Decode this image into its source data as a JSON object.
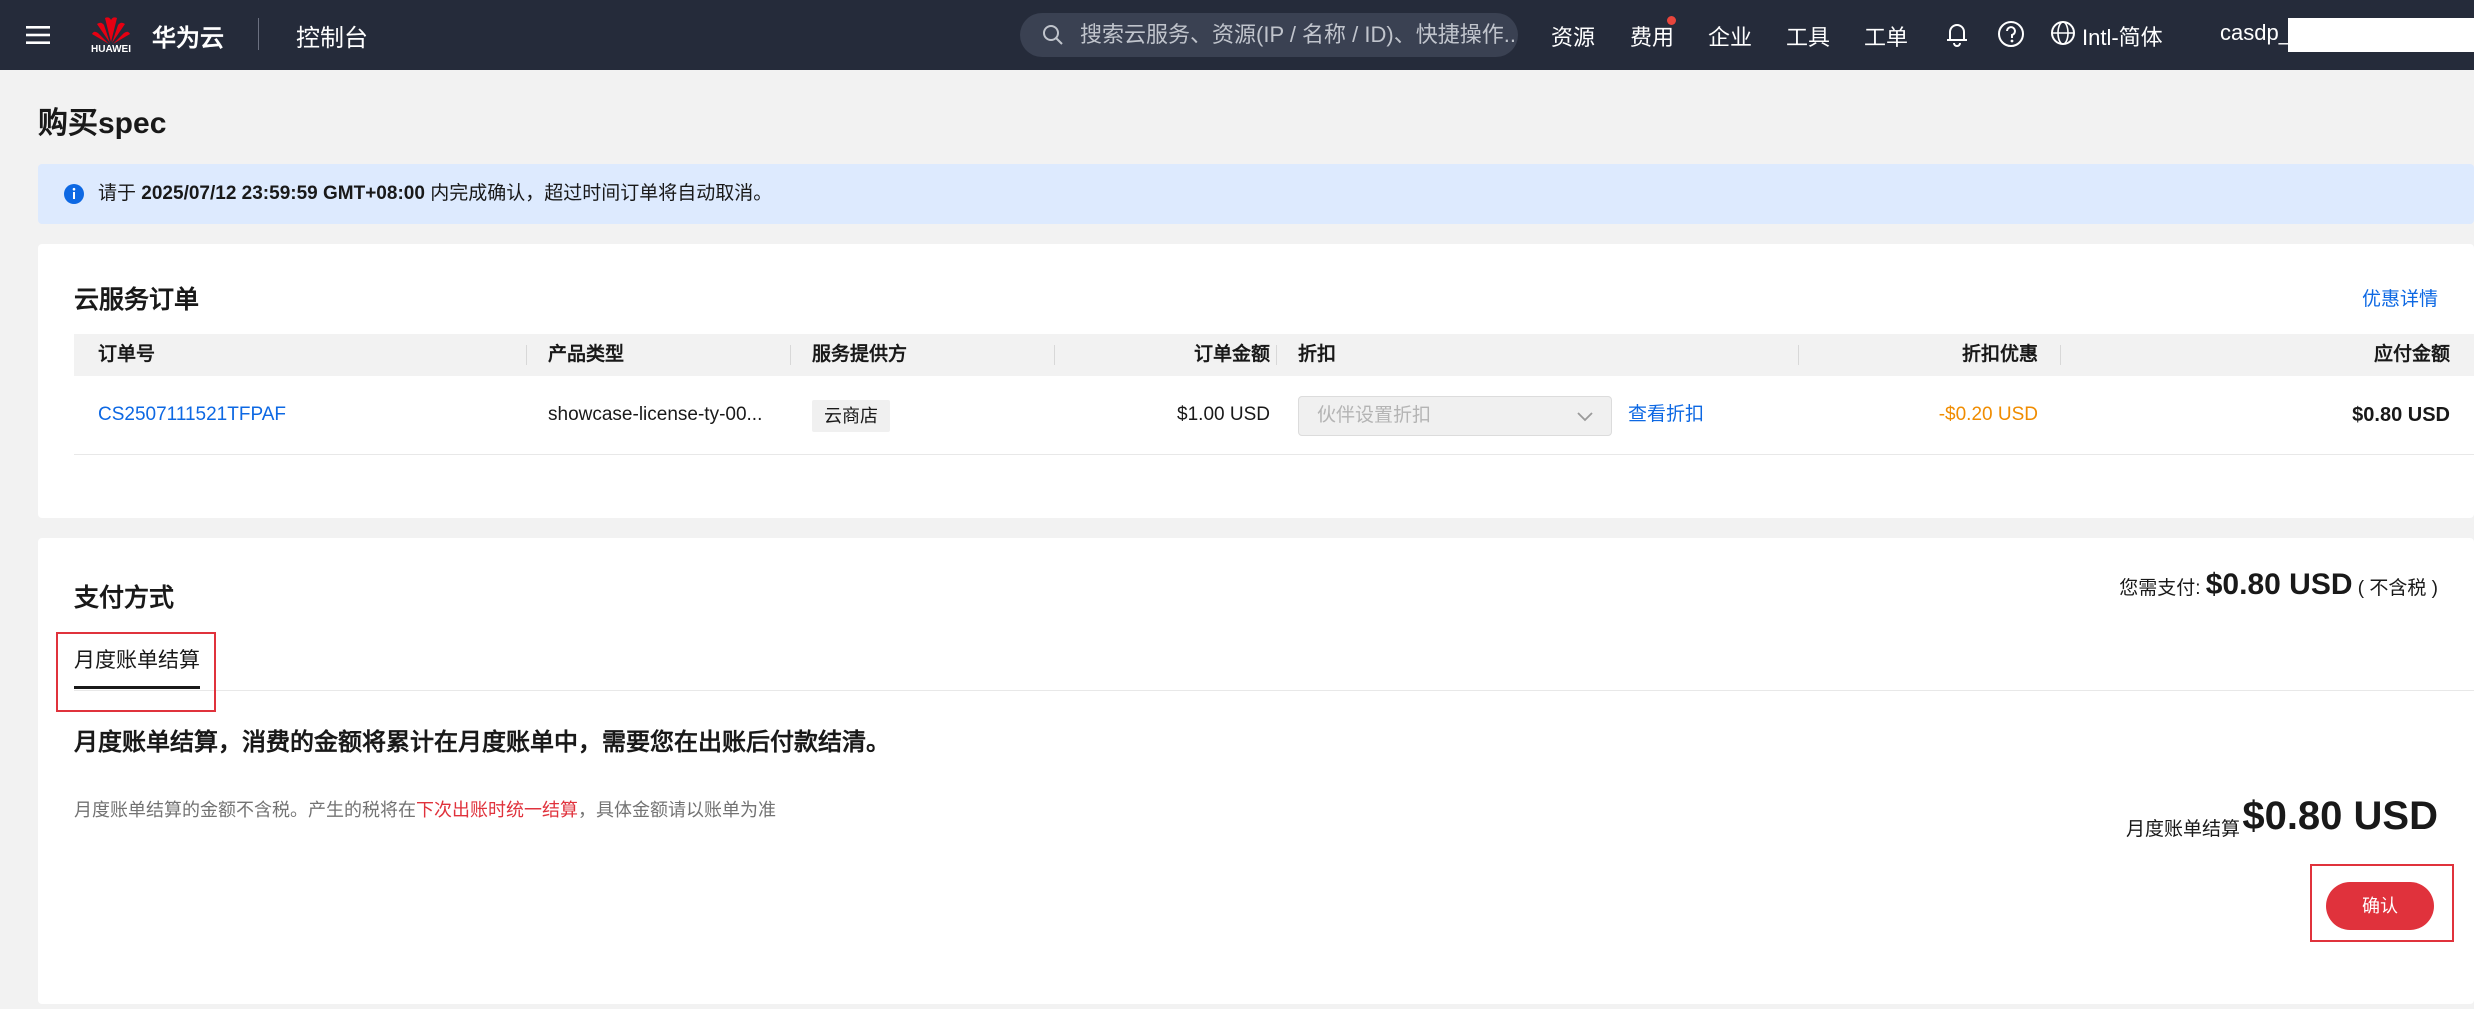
{
  "topbar": {
    "logo_text": "HUAWEI",
    "brand": "华为云",
    "console": "控制台",
    "search_placeholder": "搜索云服务、资源(IP / 名称 / ID)、快捷操作...",
    "nav": [
      "资源",
      "费用",
      "企业",
      "工具",
      "工单"
    ],
    "language": "Intl-简体",
    "user": "casdp_"
  },
  "page": {
    "title": "购买spec"
  },
  "notice": {
    "prefix": "请于",
    "deadline": "2025/07/12 23:59:59 GMT+08:00",
    "suffix": "内完成确认，超过时间订单将自动取消。"
  },
  "order": {
    "title": "云服务订单",
    "coupon_link": "优惠详情",
    "columns": [
      "订单号",
      "产品类型",
      "服务提供方",
      "订单金额",
      "折扣",
      "折扣优惠",
      "应付金额"
    ],
    "row": {
      "order_id": "CS2507111521TFPAF",
      "product_type": "showcase-license-ty-00...",
      "provider": "云商店",
      "amount": "$1.00 USD",
      "discount_placeholder": "伙伴设置折扣",
      "view_discount": "查看折扣",
      "discount_value": "-$0.20 USD",
      "payable": "$0.80 USD"
    }
  },
  "payment": {
    "title": "支付方式",
    "need_pay_label": "您需支付:",
    "need_pay_amount": "$0.80 USD",
    "tax_note": "( 不含税 )",
    "tab": "月度账单结算",
    "description": "月度账单结算，消费的金额将累计在月度账单中，需要您在出账后付款结清。",
    "note_before": "月度账单结算的金额不含税。产生的税将在",
    "note_highlight": "下次出账时统一结算",
    "note_after": "，具体金额请以账单为准",
    "total_label": "月度账单结算",
    "total_amount": "$0.80 USD",
    "confirm_label": "确认"
  },
  "colors": {
    "topbar_bg": "#252b3a",
    "link": "#0d68e3",
    "accent_red": "#e0323c",
    "discount_orange": "#f08c00",
    "notice_bg": "#ddeafe"
  },
  "icons": [
    "menu-icon",
    "huawei-logo-icon",
    "search-icon",
    "bell-icon",
    "help-icon",
    "globe-icon",
    "info-icon",
    "chevron-down-icon"
  ]
}
